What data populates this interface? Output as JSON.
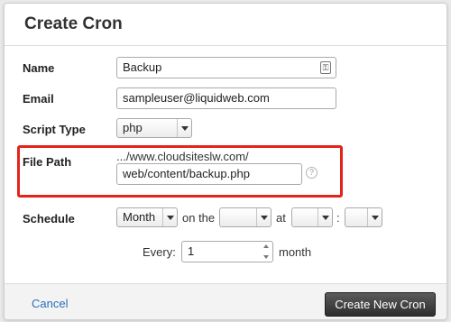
{
  "dialog": {
    "title": "Create Cron"
  },
  "form": {
    "name": {
      "label": "Name",
      "value": "Backup",
      "icon": "key-icon"
    },
    "email": {
      "label": "Email",
      "value": "sampleuser@liquidweb.com"
    },
    "script_type": {
      "label": "Script Type",
      "value": "php"
    },
    "file_path": {
      "label": "File Path",
      "prefix": ".../www.cloudsiteslw.com/",
      "value": "web/content/backup.php",
      "help_icon": "question-circle-icon"
    },
    "schedule": {
      "label": "Schedule",
      "frequency": "Month",
      "on_the_text": "on the",
      "day": "",
      "at_text": "at",
      "hour": "",
      "separator": ":",
      "minute": "",
      "every_label": "Every:",
      "every_value": "1",
      "every_unit": "month"
    }
  },
  "footer": {
    "cancel_label": "Cancel",
    "submit_label": "Create New Cron"
  },
  "colors": {
    "highlight": "#e4231b",
    "link": "#2a6ebb",
    "primary_button": "#3a3a3a"
  }
}
